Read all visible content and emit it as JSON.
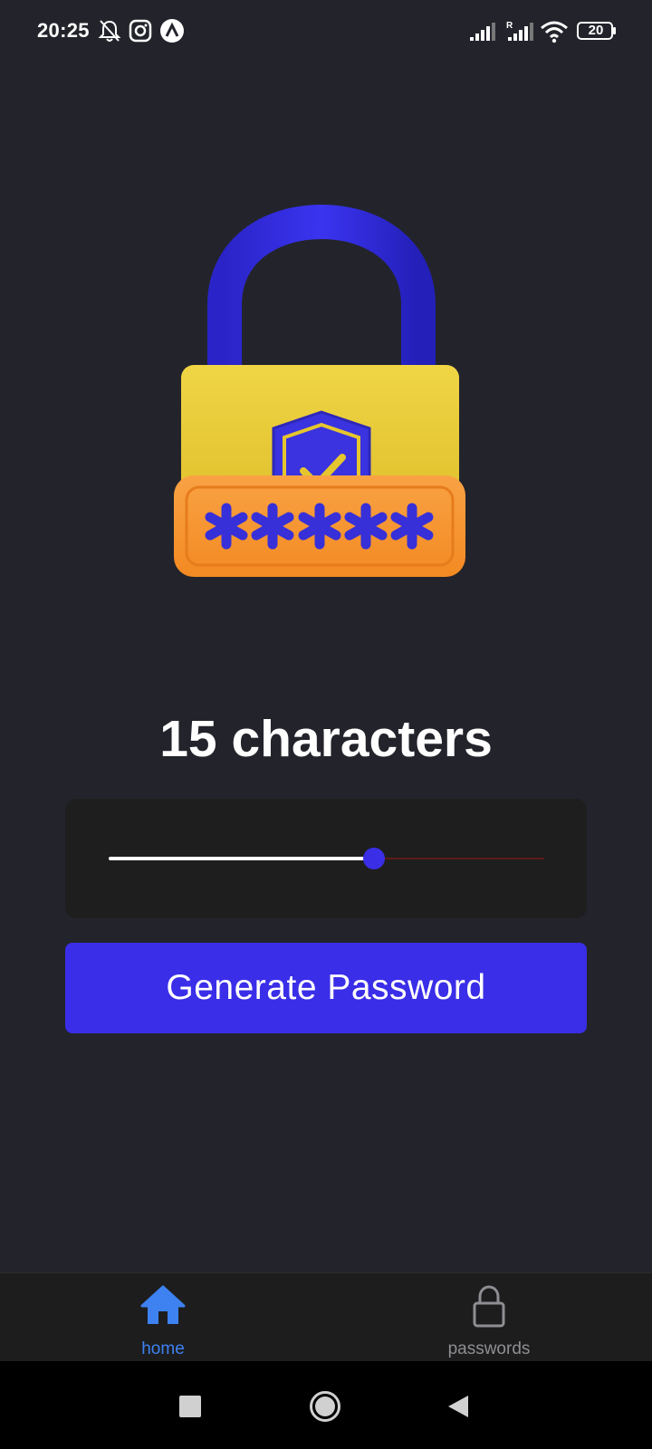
{
  "status_bar": {
    "time": "20:25",
    "battery_level": "20",
    "icons": [
      "mute-bell-icon",
      "instagram-icon",
      "app-logo-icon",
      "signal-icon",
      "roaming-signal-icon",
      "wifi-icon",
      "battery-icon"
    ]
  },
  "illustration": {
    "icon": "padlock-shield-password-icon",
    "colors": {
      "shackle": "#2a24e0",
      "body": "#e8c934",
      "plate": "#f7932e",
      "asterisks": "#3730d8"
    }
  },
  "length": {
    "value": "15",
    "unit": "characters",
    "slider_fraction": 0.61
  },
  "actions": {
    "generate_label": "Generate Password"
  },
  "tabs": [
    {
      "label": "home",
      "icon": "home-icon",
      "active": true
    },
    {
      "label": "passwords",
      "icon": "lock-icon",
      "active": false
    }
  ],
  "colors": {
    "background": "#23242b",
    "accent": "#3a2ee8",
    "active_tab": "#3d82f0",
    "inactive_tab": "#8e8e93"
  },
  "nav": {
    "icons": [
      "recents-square-icon",
      "home-circle-icon",
      "back-triangle-icon"
    ]
  }
}
